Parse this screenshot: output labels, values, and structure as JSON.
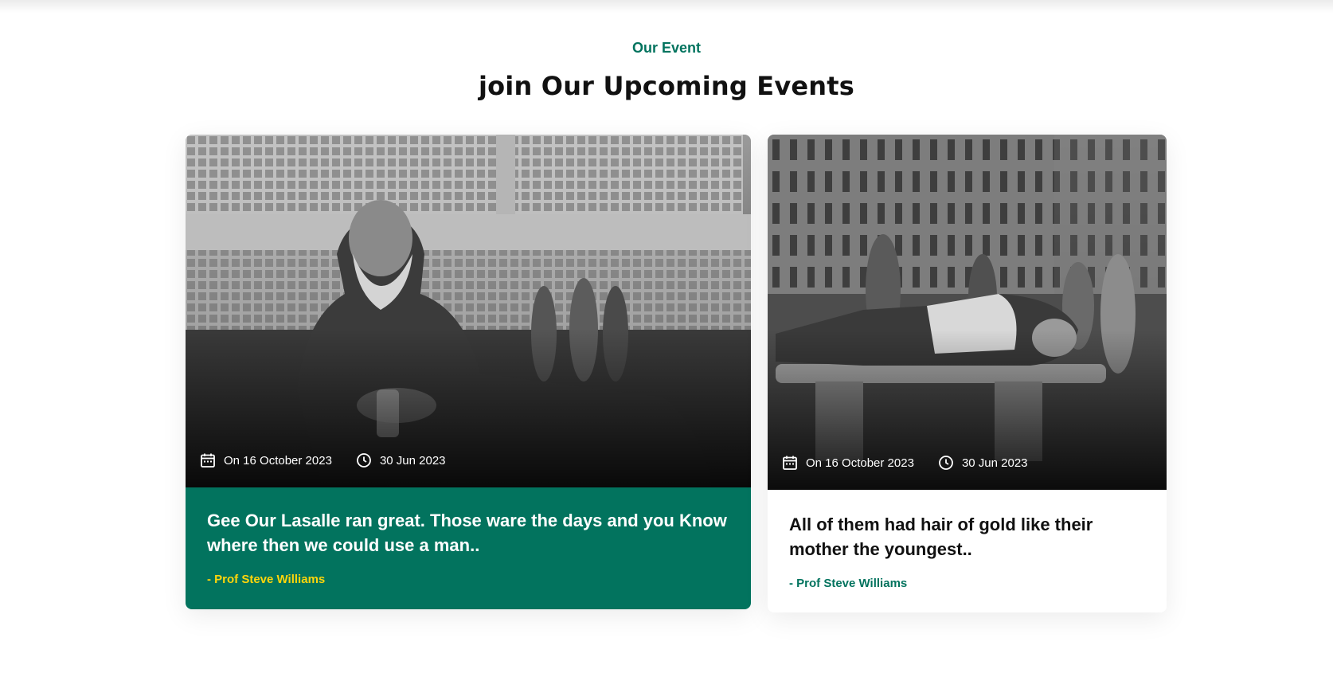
{
  "section": {
    "eyebrow": "Our Event",
    "heading": "join Our Upcoming Events"
  },
  "events": [
    {
      "date": "On 16 October 2023",
      "time": "30 Jun 2023",
      "title": "Gee Our Lasalle ran great. Those ware the days and you Know where then we could use a man..",
      "author": "- Prof Steve Williams",
      "icons": [
        "calendar-icon",
        "clock-icon"
      ]
    },
    {
      "date": "On 16 October 2023",
      "time": "30 Jun 2023",
      "title": "All of them had hair of gold like their mother the youngest..",
      "author": "- Prof Steve Williams",
      "icons": [
        "calendar-icon",
        "clock-icon"
      ]
    }
  ],
  "colors": {
    "accent": "#02735E",
    "author_highlight": "#FFD60A",
    "heading": "#111111"
  }
}
